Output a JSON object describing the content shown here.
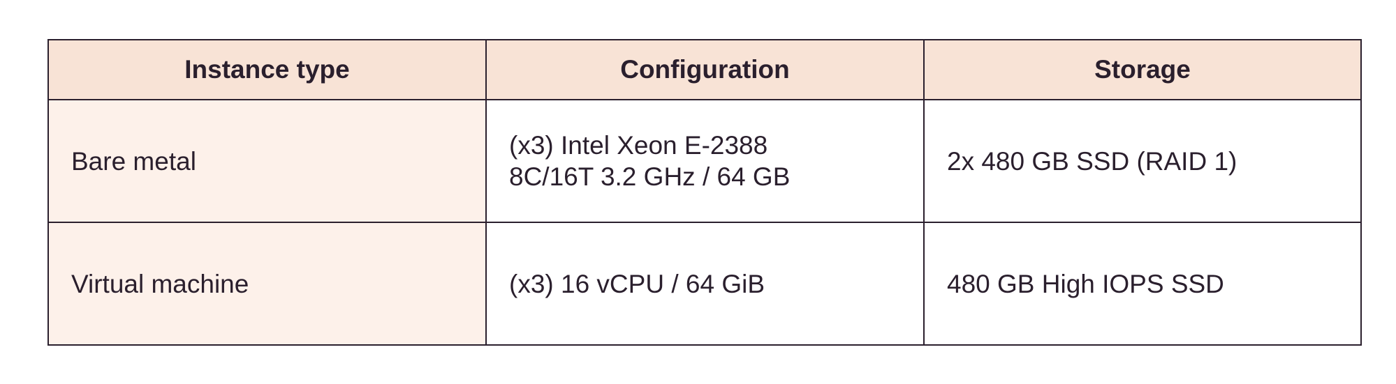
{
  "table": {
    "headers": [
      "Instance type",
      "Configuration",
      "Storage"
    ],
    "rows": [
      {
        "instance_type": "Bare metal",
        "configuration_lines": [
          "(x3) Intel Xeon E-2388",
          "8C/16T 3.2 GHz / 64 GB"
        ],
        "storage": "2x 480 GB SSD (RAID 1)"
      },
      {
        "instance_type": "Virtual machine",
        "configuration_lines": [
          "(x3) 16 vCPU / 64 GiB"
        ],
        "storage": "480 GB High IOPS SSD"
      }
    ]
  },
  "colors": {
    "header_bg": "#f8e3d6",
    "first_column_bg": "#fdf1ea",
    "border": "#2a1f2d",
    "text": "#2a1f2d"
  }
}
